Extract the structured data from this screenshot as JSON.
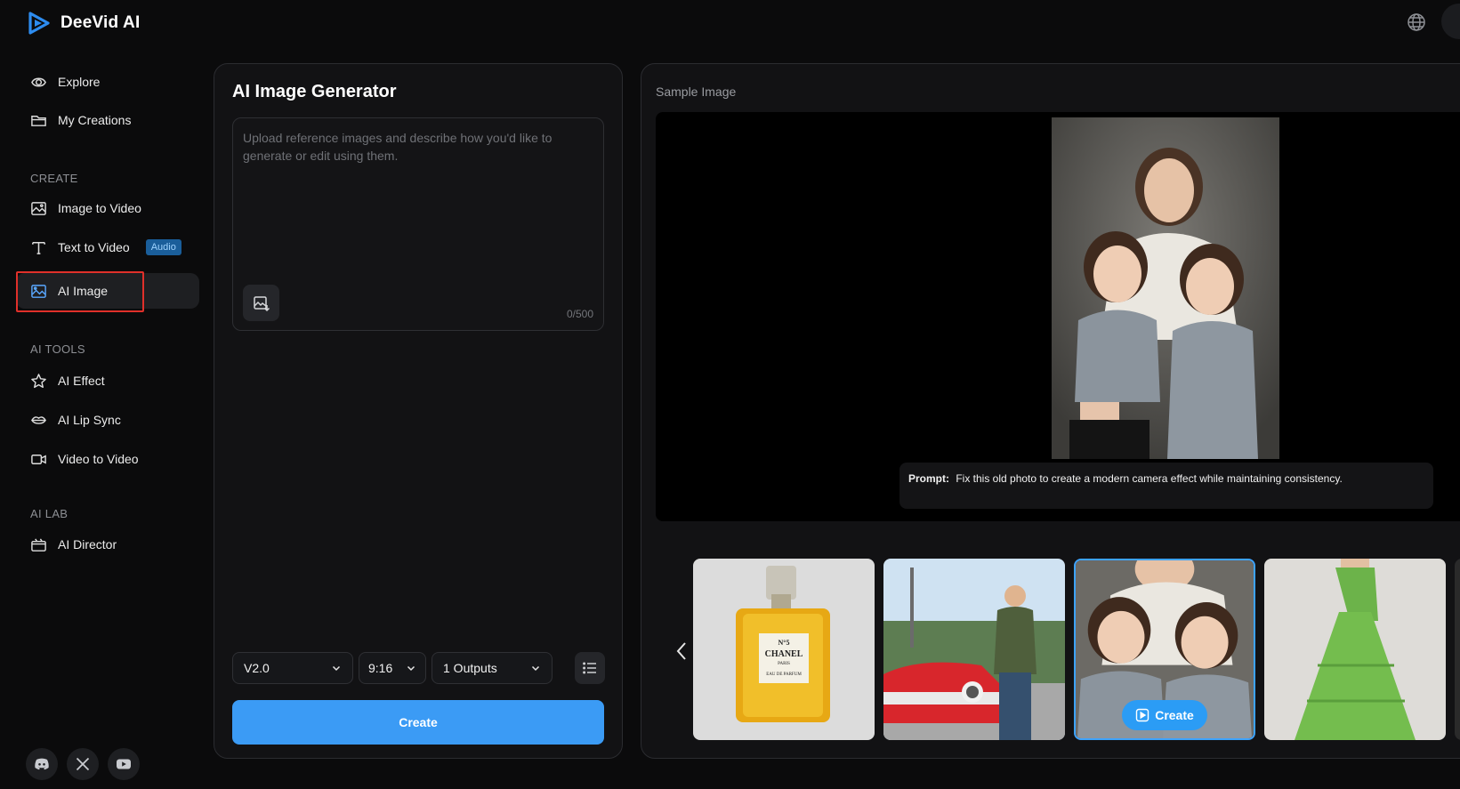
{
  "app": {
    "name": "DeeVid AI"
  },
  "header": {
    "globe_icon": "globe-icon"
  },
  "sidebar": {
    "items": [
      {
        "label": "Explore",
        "icon": "eye-icon"
      },
      {
        "label": "My Creations",
        "icon": "folder-icon"
      }
    ],
    "create_section": "CREATE",
    "create_items": [
      {
        "label": "Image to Video",
        "icon": "image-icon"
      },
      {
        "label": "Text to Video",
        "icon": "text-icon",
        "badge": "Audio"
      },
      {
        "label": "AI Image",
        "icon": "ai-image-icon",
        "active": true
      }
    ],
    "tools_section": "AI TOOLS",
    "tools_items": [
      {
        "label": "AI Effect",
        "icon": "star-icon"
      },
      {
        "label": "AI Lip Sync",
        "icon": "lips-icon"
      },
      {
        "label": "Video to Video",
        "icon": "video-icon"
      }
    ],
    "lab_section": "AI LAB",
    "lab_items": [
      {
        "label": "AI Director",
        "icon": "director-icon"
      }
    ],
    "social": [
      "discord-icon",
      "x-icon",
      "youtube-icon"
    ]
  },
  "generator": {
    "title": "AI Image Generator",
    "prompt_placeholder": "Upload reference images and describe how you'd like to generate or edit using them.",
    "prompt_value": "",
    "char_count": "0/500",
    "model_select": "V2.0",
    "ratio_select": "9:16",
    "outputs_select": "1 Outputs",
    "create_label": "Create"
  },
  "sample": {
    "label": "Sample Image",
    "prompt_label": "Prompt:",
    "prompt_text": "Fix this old photo to create a modern camera effect while maintaining consistency.",
    "thumbnails": [
      {
        "name": "perfume-thumbnail",
        "text": "N°5 CHANEL PARIS EAU DE PARFUM"
      },
      {
        "name": "car-man-thumbnail"
      },
      {
        "name": "mother-daughters-thumbnail",
        "selected": true,
        "create_label": "Create"
      },
      {
        "name": "green-dress-thumbnail"
      }
    ]
  },
  "colors": {
    "accent": "#3b9bf5",
    "highlight": "#e0302a",
    "badge": "#1a5e9a"
  }
}
